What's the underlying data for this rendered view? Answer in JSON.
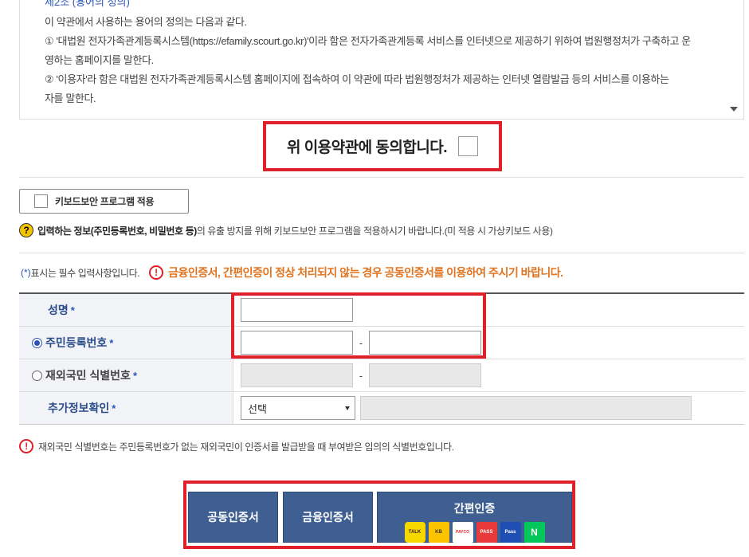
{
  "terms": {
    "article_title": "제2조 (용어의 정의)",
    "lines": [
      "이 약관에서 사용하는 용어의 정의는 다음과 같다.",
      "① '대법원 전자가족관계등록시스템(https://efamily.scourt.go.kr)'이라 함은 전자가족관계등록 서비스를 인터넷으로 제공하기 위하여 법원행정처가 구축하고 운",
      "영하는 홈페이지를 말한다.",
      "② '이용자'라 함은 대법원 전자가족관계등록시스템 홈페이지에 접속하여 이 약관에 따라 법원행정처가 제공하는 인터넷 열람발급 등의 서비스를 이용하는",
      "자를 말한다."
    ]
  },
  "agree": {
    "label": "위 이용약관에 동의합니다."
  },
  "keyboard": {
    "button_label": "키보드보안 프로그램 적용",
    "note_prefix": "입력하는 정보",
    "note_bold": "(주민등록번호, 비밀번호 등)",
    "note_suffix": "의 유출 방지를 위해 키보드보안 프로그램을 적용하시기 바랍니다.(미 적용 시 가상키보드 사용)"
  },
  "notice": {
    "required_star": "(*)",
    "required_text": "표시는 필수 입력사항입니다.",
    "warning": "금융인증서, 간편인증이 정상 처리되지 않는 경우 공동인증서를 이용하여 주시기 바랍니다."
  },
  "form": {
    "name_label": "성명",
    "rrn_label": "주민등록번호",
    "foreign_label": "재외국민 식별번호",
    "extra_label": "추가정보확인",
    "star": "*",
    "dash": "-",
    "select_value": "선택"
  },
  "bottom_note": "재외국민 식별번호는 주민등록번호가 없는 재외국민이 인증서를 발급받을 때 부여받은 임의의 식별번호입니다.",
  "auth": {
    "joint_cert": "공동인증서",
    "financial_cert": "금융인증서",
    "easy_auth": "간편인증",
    "logos": [
      "TALK",
      "KB",
      "PAYCO",
      "PASS",
      "Pass",
      "N"
    ]
  },
  "colors": {
    "accent_red": "#e0202a",
    "warning_orange": "#e07420",
    "button_blue": "#3f5f92",
    "label_blue": "#2a4c8a"
  }
}
